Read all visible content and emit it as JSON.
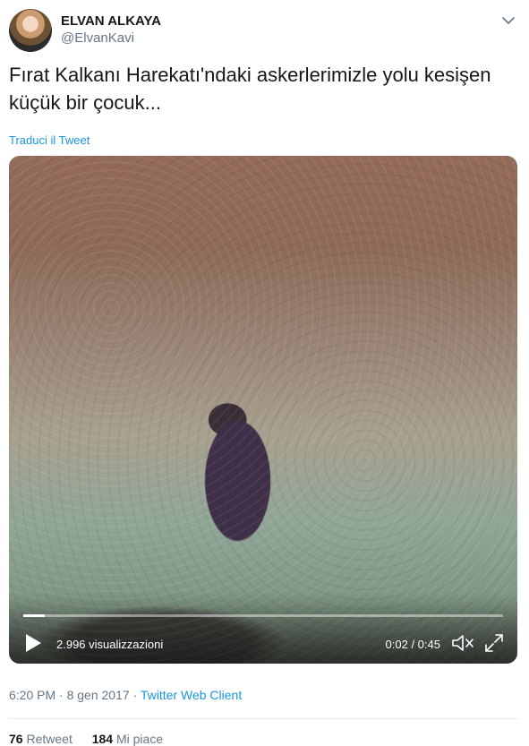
{
  "author": {
    "name": "ELVAN ALKAYA",
    "handle": "@ElvanKavi"
  },
  "tweet": {
    "text": "Fırat Kalkanı Harekatı'ndaki askerlerimizle yolu kesişen küçük bir çocuk...",
    "translate_label": "Traduci il Tweet"
  },
  "video": {
    "views": "2.996 visualizzazioni",
    "time": "0:02 / 0:45",
    "progress": 0.044
  },
  "meta": {
    "time": "6:20 PM",
    "date": "8 gen 2017",
    "separator": "·",
    "client": "Twitter Web Client"
  },
  "stats": {
    "retweets_count": "76",
    "retweets_label": "Retweet",
    "likes_count": "184",
    "likes_label": "Mi piace"
  },
  "colors": {
    "link": "#1b95e0",
    "secondary_text": "#657786",
    "primary_text": "#14171a"
  },
  "icons": {
    "menu": "chevron-down-icon",
    "play": "play-icon",
    "mute": "volume-muted-icon",
    "fullscreen": "fullscreen-icon"
  }
}
